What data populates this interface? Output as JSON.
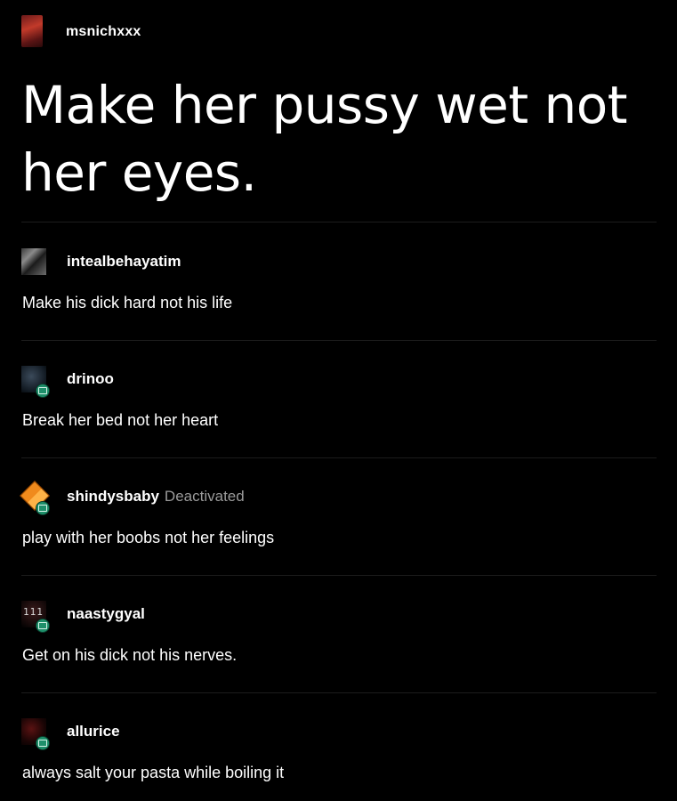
{
  "post": {
    "username": "msnichxxx",
    "title": "Make her pussy wet not her eyes."
  },
  "replies": [
    {
      "username": "intealbehayatim",
      "text": "Make his dick hard not his life",
      "deactivated": "",
      "avatar_icon": "user-avatar-photo"
    },
    {
      "username": "drinoo",
      "text": "Break her bed not her heart",
      "deactivated": "",
      "avatar_icon": "user-avatar-photo"
    },
    {
      "username": "shindysbaby",
      "text": "play with her boobs not her feelings",
      "deactivated": "Deactivated",
      "avatar_icon": "diamond-avatar"
    },
    {
      "username": "naastygyal",
      "text": "Get on his dick not his nerves.",
      "deactivated": "",
      "avatar_icon": "user-avatar-photo",
      "avatar_text": "111"
    },
    {
      "username": "allurice",
      "text": "always salt your pasta while boiling it",
      "deactivated": "",
      "avatar_icon": "user-avatar-photo"
    }
  ],
  "colors": {
    "background": "#000000",
    "text": "#ffffff",
    "muted": "#9a9a9a",
    "divider": "#1c1c1c",
    "badge": "#1e8f6a"
  }
}
